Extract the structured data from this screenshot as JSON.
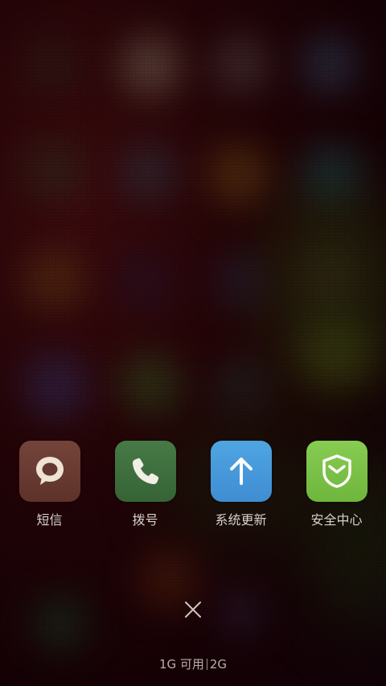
{
  "recent_apps": [
    {
      "label": "短信",
      "icon": "message-bubble-icon",
      "color": "#6b3b33"
    },
    {
      "label": "拨号",
      "icon": "phone-handset-icon",
      "color": "#3f6e3f"
    },
    {
      "label": "系统更新",
      "icon": "arrow-up-icon",
      "color": "#4a9ad8"
    },
    {
      "label": "安全中心",
      "icon": "shield-check-icon",
      "color": "#7cc24a"
    }
  ],
  "memory": {
    "available": "1G 可用",
    "total": "2G"
  },
  "colors": {
    "label_text": "#d8d0cc",
    "memory_text": "#b8aeaa"
  }
}
